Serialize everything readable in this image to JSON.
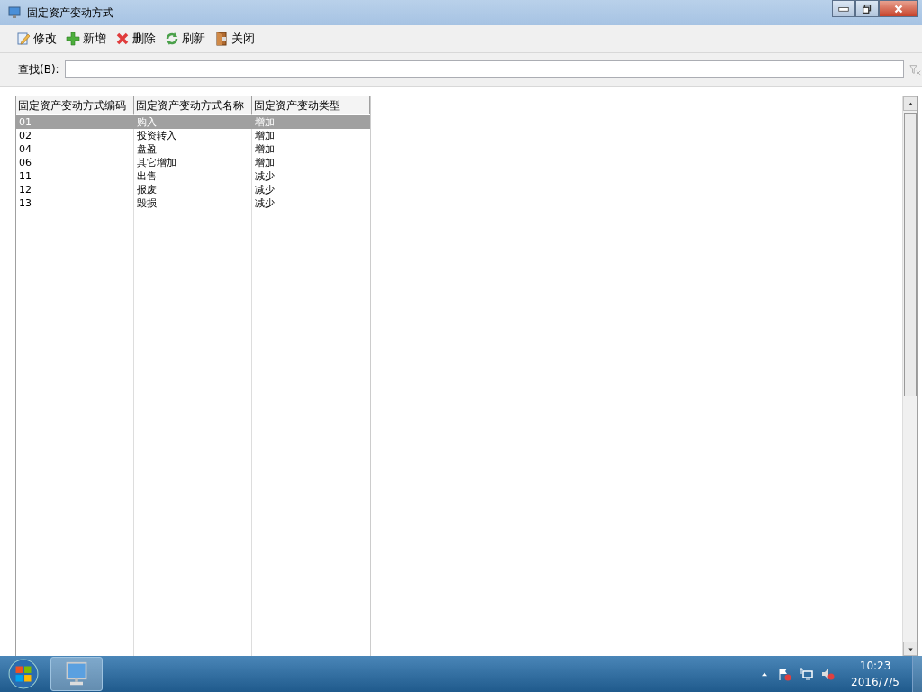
{
  "window": {
    "title": "固定资产变动方式"
  },
  "toolbar": [
    {
      "label": "修改",
      "kind": "edit"
    },
    {
      "label": "新增",
      "kind": "add"
    },
    {
      "label": "删除",
      "kind": "delete"
    },
    {
      "label": "刷新",
      "kind": "refresh"
    },
    {
      "label": "关闭",
      "kind": "close"
    }
  ],
  "search": {
    "label": "查找(B):"
  },
  "table": {
    "columns": [
      "固定资产变动方式编码",
      "固定资产变动方式名称",
      "固定资产变动类型"
    ],
    "rows": [
      {
        "cells": [
          "01",
          "购入",
          "增加"
        ],
        "selected": true
      },
      {
        "cells": [
          "02",
          "投资转入",
          "增加"
        ],
        "selected": false
      },
      {
        "cells": [
          "04",
          "盘盈",
          "增加"
        ],
        "selected": false
      },
      {
        "cells": [
          "06",
          "其它增加",
          "增加"
        ],
        "selected": false
      },
      {
        "cells": [
          "11",
          "出售",
          "减少"
        ],
        "selected": false
      },
      {
        "cells": [
          "12",
          "报废",
          "减少"
        ],
        "selected": false
      },
      {
        "cells": [
          "13",
          "毁损",
          "减少"
        ],
        "selected": false
      }
    ]
  },
  "taskbar": {
    "time": "10:23",
    "date": "2016/7/5"
  }
}
